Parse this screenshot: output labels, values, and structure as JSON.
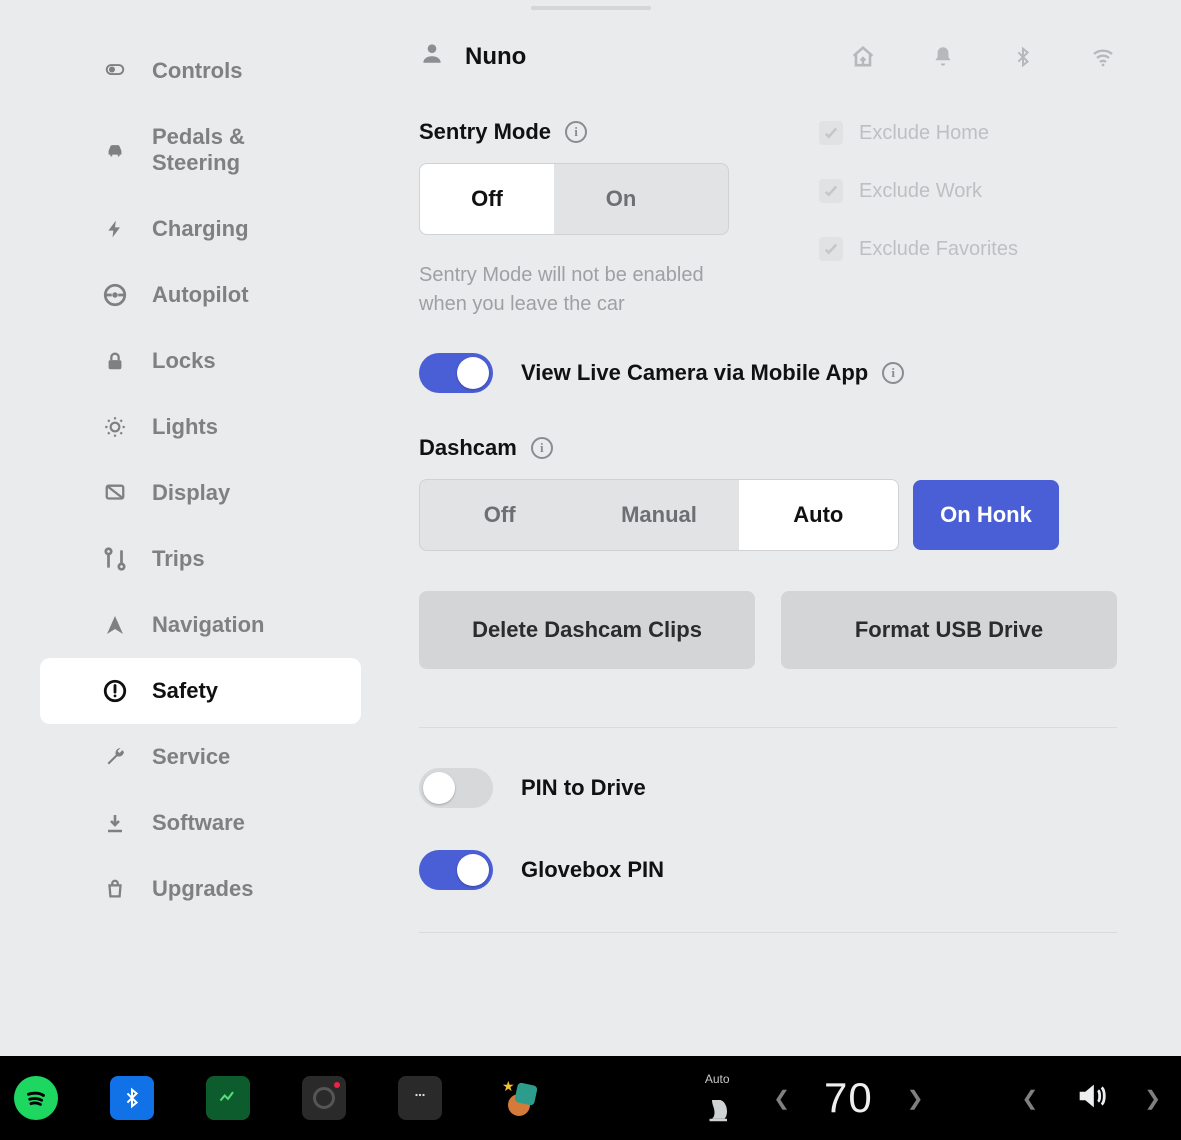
{
  "profile": {
    "name": "Nuno"
  },
  "sidebar": {
    "items": [
      {
        "label": "Controls",
        "icon": "toggle-icon"
      },
      {
        "label": "Pedals & Steering",
        "icon": "car-icon"
      },
      {
        "label": "Charging",
        "icon": "bolt-icon"
      },
      {
        "label": "Autopilot",
        "icon": "steering-icon"
      },
      {
        "label": "Locks",
        "icon": "lock-icon"
      },
      {
        "label": "Lights",
        "icon": "lights-icon"
      },
      {
        "label": "Display",
        "icon": "display-icon"
      },
      {
        "label": "Trips",
        "icon": "trips-icon"
      },
      {
        "label": "Navigation",
        "icon": "nav-icon"
      },
      {
        "label": "Safety",
        "icon": "alert-icon",
        "active": true
      },
      {
        "label": "Service",
        "icon": "wrench-icon"
      },
      {
        "label": "Software",
        "icon": "download-icon"
      },
      {
        "label": "Upgrades",
        "icon": "bag-icon"
      }
    ]
  },
  "safety": {
    "sentry": {
      "title": "Sentry Mode",
      "options": [
        "Off",
        "On"
      ],
      "selected": "Off",
      "helper": "Sentry Mode will not be enabled when you leave the car",
      "excludes": [
        {
          "label": "Exclude Home",
          "checked": true
        },
        {
          "label": "Exclude Work",
          "checked": true
        },
        {
          "label": "Exclude Favorites",
          "checked": true
        }
      ]
    },
    "live_camera": {
      "label": "View Live Camera via Mobile App",
      "on": true
    },
    "dashcam": {
      "title": "Dashcam",
      "options": [
        "Off",
        "Manual",
        "Auto",
        "On Honk"
      ],
      "selected": "Auto",
      "honk_selected": true
    },
    "buttons": {
      "delete_clips": "Delete Dashcam Clips",
      "format_usb": "Format USB Drive"
    },
    "pin_to_drive": {
      "label": "PIN to Drive",
      "on": false
    },
    "glovebox_pin": {
      "label": "Glovebox PIN",
      "on": true
    }
  },
  "dock": {
    "climate_mode": "Auto",
    "temperature": "70"
  }
}
